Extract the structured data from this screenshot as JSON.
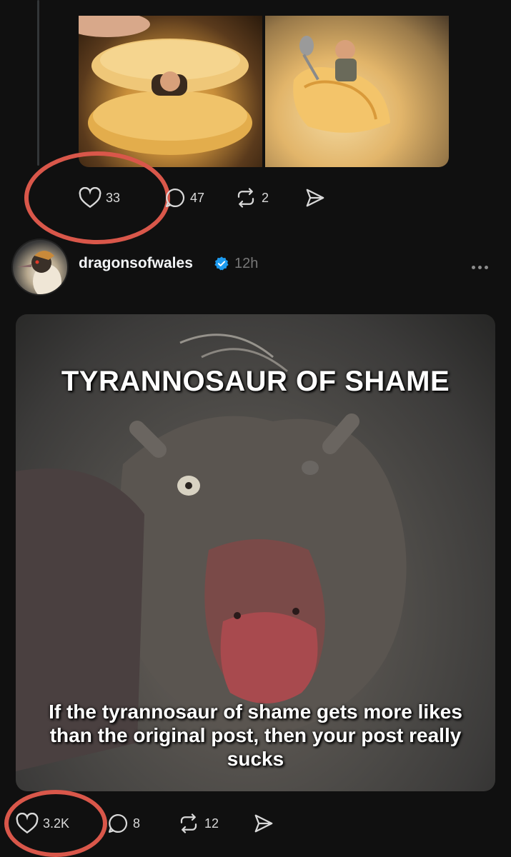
{
  "post1": {
    "actions": {
      "likes": "33",
      "replies": "47",
      "reposts": "2"
    }
  },
  "post2": {
    "author": {
      "username": "dragonsofwales",
      "time": "12h"
    },
    "image": {
      "title": "TYRANNOSAUR OF SHAME",
      "caption": "If the tyrannosaur of shame gets more likes than the original post, then your post really sucks"
    },
    "actions": {
      "likes": "3.2K",
      "replies": "8",
      "reposts": "12"
    }
  },
  "colors": {
    "background": "#101010",
    "annotation_ring": "#d9574a",
    "verified_badge": "#1d9bf0"
  }
}
